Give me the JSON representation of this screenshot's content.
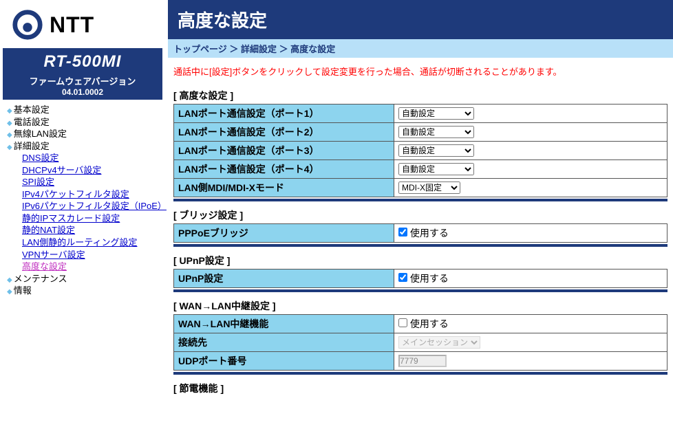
{
  "logo": {
    "brand": "NTT",
    "model": "RT-500MI",
    "fw_label": "ファームウェアバージョン",
    "fw_ver": "04.01.0002"
  },
  "nav": {
    "basic": "基本設定",
    "phone": "電話設定",
    "wlan": "無線LAN設定",
    "advanced": "詳細設定",
    "sub": {
      "dns": "DNS設定",
      "dhcpv4": "DHCPv4サーバ設定",
      "spi": "SPI設定",
      "ipv4pf": "IPv4パケットフィルタ設定",
      "ipv6pf": "IPv6パケットフィルタ設定（IPoE）",
      "ipmasq": "静的IPマスカレード設定",
      "snat": "静的NAT設定",
      "lanroute": "LAN側静的ルーティング設定",
      "vpn": "VPNサーバ設定",
      "adv": "高度な設定"
    },
    "maint": "メンテナンス",
    "info": "情報"
  },
  "page": {
    "title": "高度な設定",
    "breadcrumb": "トップページ ＞ 詳細設定 ＞ 高度な設定",
    "warning": "通話中に[設定]ボタンをクリックして設定変更を行った場合、通話が切断されることがあります。"
  },
  "sections": {
    "adv": {
      "head": "[ 高度な設定 ]",
      "rows": {
        "port1": {
          "label": "LANポート通信設定（ポート1）",
          "value": "自動設定"
        },
        "port2": {
          "label": "LANポート通信設定（ポート2）",
          "value": "自動設定"
        },
        "port3": {
          "label": "LANポート通信設定（ポート3）",
          "value": "自動設定"
        },
        "port4": {
          "label": "LANポート通信設定（ポート4）",
          "value": "自動設定"
        },
        "mdix": {
          "label": "LAN側MDI/MDI-Xモード",
          "value": "MDI-X固定"
        }
      }
    },
    "bridge": {
      "head": "[ ブリッジ設定 ]",
      "rows": {
        "pppoe": {
          "label": "PPPoEブリッジ",
          "checklabel": "使用する",
          "checked": true
        }
      }
    },
    "upnp": {
      "head": "[ UPnP設定 ]",
      "rows": {
        "upnp": {
          "label": "UPnP設定",
          "checklabel": "使用する",
          "checked": true
        }
      }
    },
    "wanlan": {
      "head": "[ WAN→LAN中継設定 ]",
      "rows": {
        "relay": {
          "label": "WAN→LAN中継機能",
          "checklabel": "使用する",
          "checked": false
        },
        "dest": {
          "label": "接続先",
          "value": "メインセッション"
        },
        "udpport": {
          "label": "UDPポート番号",
          "value": "7779"
        }
      }
    },
    "power": {
      "head": "[ 節電機能 ]"
    }
  }
}
